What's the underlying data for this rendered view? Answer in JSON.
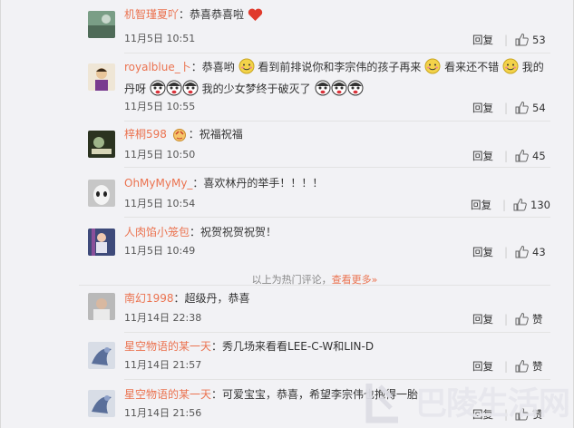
{
  "hot_comments": [
    {
      "user": "机智瑾夏吖",
      "text": "：恭喜恭喜啦",
      "time": "11月5日 10:51",
      "reply": "回复",
      "likes": "53"
    },
    {
      "user": "royalblue_卜",
      "text_a": "：恭喜哟",
      "text_b": "看到前排说你和李宗伟的孩子再来",
      "text_c": "看来还不错",
      "text_d": "我的",
      "text_e": "丹呀",
      "text_f": "我的少女梦终于破灭了",
      "time": "11月5日 10:55",
      "reply": "回复",
      "likes": "54"
    },
    {
      "user": "梓桐598",
      "text": "：祝福祝福",
      "time": "11月5日 10:50",
      "reply": "回复",
      "likes": "45"
    },
    {
      "user": "OhMyMyMy_",
      "text": "：喜欢林丹的举手！！！！",
      "time": "11月5日 10:54",
      "reply": "回复",
      "likes": "130"
    },
    {
      "user": "人肉馅小笼包",
      "text": "：祝贺祝贺祝贺！",
      "time": "11月5日 10:49",
      "reply": "回复",
      "likes": "43"
    }
  ],
  "hot_footer": {
    "text": "以上为热门评论，",
    "more": "查看更多»"
  },
  "new_comments": [
    {
      "user": "南幻1998",
      "text": "：超级丹，恭喜",
      "time": "11月14日 22:38",
      "reply": "回复",
      "like": "赞"
    },
    {
      "user": "星空物语的某一天",
      "text": "：秀几场来看看LEE-C-W和LIN-D",
      "time": "11月14日 21:57",
      "reply": "回复",
      "like": "赞"
    },
    {
      "user": "星空物语的某一天",
      "text": "：可爱宝宝，恭喜，希望李宗伟也抱得一胎",
      "time": "11月14日 21:56",
      "reply": "回复",
      "like": "赞"
    }
  ],
  "watermark": "巴陵生活网",
  "colors": {
    "username": "#eb7350",
    "background": "#f2f2f5",
    "heart": "#e0392b"
  }
}
